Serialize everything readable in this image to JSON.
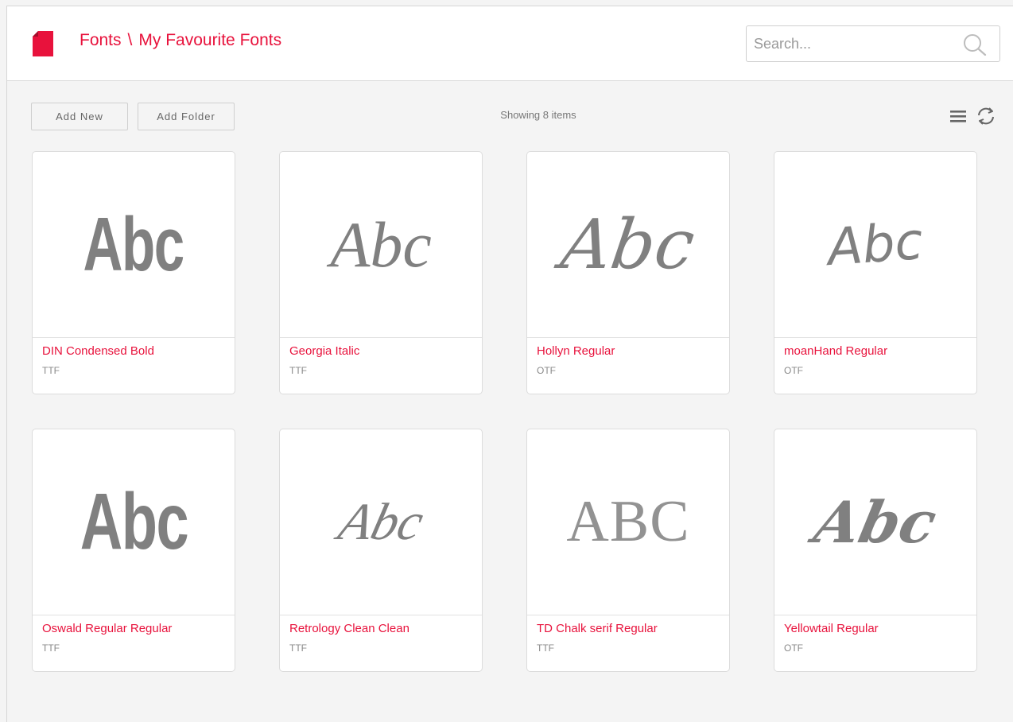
{
  "header": {
    "breadcrumb": [
      "Fonts",
      "My Favourite Fonts"
    ],
    "separator": "\\",
    "search_placeholder": "Search..."
  },
  "toolbar": {
    "add_new_label": "Add New",
    "add_folder_label": "Add Folder",
    "status_text": "Showing 8 items"
  },
  "fonts": [
    {
      "sample": "Abc",
      "name": "DIN Condensed Bold",
      "type": "TTF"
    },
    {
      "sample": "Abc",
      "name": "Georgia Italic",
      "type": "TTF"
    },
    {
      "sample": "Abc",
      "name": "Hollyn Regular",
      "type": "OTF"
    },
    {
      "sample": "Abc",
      "name": "moanHand Regular",
      "type": "OTF"
    },
    {
      "sample": "Abc",
      "name": "Oswald Regular Regular",
      "type": "TTF"
    },
    {
      "sample": "Abc",
      "name": "Retrology Clean Clean",
      "type": "TTF"
    },
    {
      "sample": "ABC",
      "name": "TD Chalk serif Regular",
      "type": "TTF"
    },
    {
      "sample": "Abc",
      "name": "Yellowtail Regular",
      "type": "OTF"
    }
  ],
  "colors": {
    "accent": "#e8123c",
    "sample_text": "#808080",
    "background": "#f4f4f4"
  },
  "icons": [
    "file-icon",
    "search-icon",
    "list-view-icon",
    "refresh-icon"
  ]
}
